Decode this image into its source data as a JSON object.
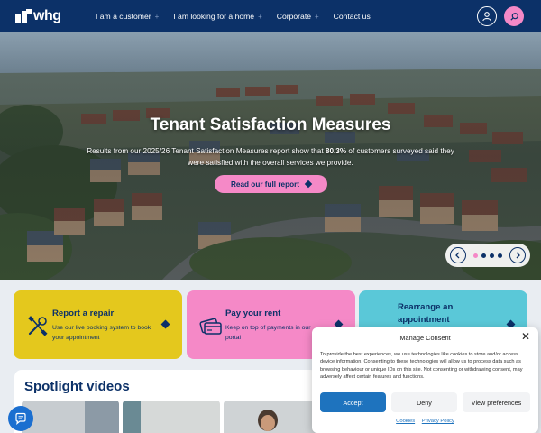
{
  "header": {
    "logo_text": "whg",
    "nav": [
      {
        "label": "I am a customer",
        "plus": "+"
      },
      {
        "label": "I am looking for a home",
        "plus": "+"
      },
      {
        "label": "Corporate",
        "plus": "+"
      },
      {
        "label": "Contact us",
        "plus": ""
      }
    ],
    "account_icon": "user-icon",
    "search_icon": "search-icon"
  },
  "hero": {
    "title": "Tenant Satisfaction Measures",
    "text_before": "Results from our 2025/26 Tenant Satisfaction Measures report show that ",
    "text_highlight": "80.3%",
    "text_after": " of customers surveyed said they were satisfied with the overall services we provide.",
    "button_label": "Read our full report",
    "carousel": {
      "slides": 4,
      "active_index": 0
    }
  },
  "cards": [
    {
      "title": "Report a repair",
      "desc": "Use our live booking system to book your appointment",
      "color": "#e4c81d",
      "icon": "tools-icon"
    },
    {
      "title": "Pay your rent",
      "desc": "Keep on top of payments in our portal",
      "color": "#f589c7",
      "icon": "payment-card-icon"
    },
    {
      "title": "Rearrange an appointment",
      "desc": "",
      "color": "#5ac8d8",
      "icon": "calendar-icon"
    }
  ],
  "spotlight": {
    "title": "Spotlight videos"
  },
  "consent": {
    "title": "Manage Consent",
    "body": "To provide the best experiences, we use technologies like cookies to store and/or access device information. Consenting to these technologies will allow us to process data such as browsing behaviour or unique IDs on this site. Not consenting or withdrawing consent, may adversely affect certain features and functions.",
    "accept_label": "Accept",
    "deny_label": "Deny",
    "preferences_label": "View preferences",
    "cookies_link": "Cookies",
    "privacy_link": "Privacy Policy"
  },
  "colors": {
    "navy": "#0c3168",
    "pink": "#f589c7",
    "yellow": "#e4c81d",
    "cyan": "#5ac8d8",
    "accept_blue": "#1e73be"
  }
}
